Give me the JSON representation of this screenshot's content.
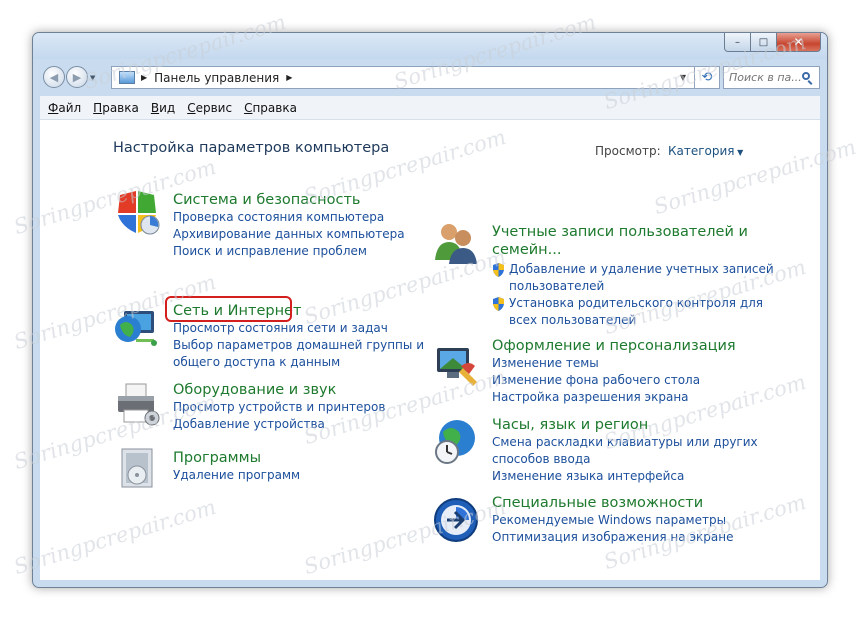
{
  "window": {
    "controls": {
      "minimize": "–",
      "maximize": "□",
      "close": "✕"
    }
  },
  "nav": {
    "back_icon": "back-arrow-icon",
    "forward_icon": "forward-arrow-icon",
    "address": {
      "segment": "Панель управления"
    },
    "search_placeholder": "Поиск в па..."
  },
  "menu": [
    "Файл",
    "Правка",
    "Вид",
    "Сервис",
    "Справка"
  ],
  "content": {
    "heading": "Настройка параметров компьютера",
    "view_label": "Просмотр:",
    "view_value": "Категория",
    "left_categories": [
      {
        "title": "Система и безопасность",
        "links": [
          "Проверка состояния компьютера",
          "Архивирование данных компьютера",
          "Поиск и исправление проблем"
        ],
        "icon": "shield-icon"
      },
      {
        "title": "Сеть и Интернет",
        "links": [
          "Просмотр состояния сети и задач",
          "Выбор параметров домашней группы и",
          "общего доступа к данным"
        ],
        "icon": "network-globe-icon"
      },
      {
        "title": "Оборудование и звук",
        "links": [
          "Просмотр устройств и принтеров",
          "Добавление устройства"
        ],
        "icon": "printer-icon"
      },
      {
        "title": "Программы",
        "links": [
          "Удаление программ"
        ],
        "icon": "programs-icon"
      }
    ],
    "right_categories": [
      {
        "title_line1": "Учетные записи пользователей и",
        "title_line2": "семейн...",
        "links": [
          "Добавление и удаление учетных записей",
          "пользователей",
          "Установка родительского контроля для",
          "всех пользователей"
        ],
        "icon": "users-icon"
      },
      {
        "title": "Оформление и персонализация",
        "links": [
          "Изменение темы",
          "Изменение фона рабочего стола",
          "Настройка разрешения экрана"
        ],
        "icon": "appearance-icon"
      },
      {
        "title": "Часы, язык и регион",
        "links": [
          "Смена раскладки клавиатуры или других",
          "способов ввода",
          "Изменение языка интерфейса"
        ],
        "icon": "clock-globe-icon"
      },
      {
        "title": "Специальные возможности",
        "links": [
          "Рекомендуемые Windows параметры",
          "Оптимизация изображения на экране"
        ],
        "icon": "accessibility-icon"
      }
    ]
  },
  "watermark": "Soringpcrepair.com",
  "colors": {
    "accent_green": "#1e7a2e",
    "link_blue": "#1c4f9c",
    "highlight_red": "#d41f1f"
  }
}
